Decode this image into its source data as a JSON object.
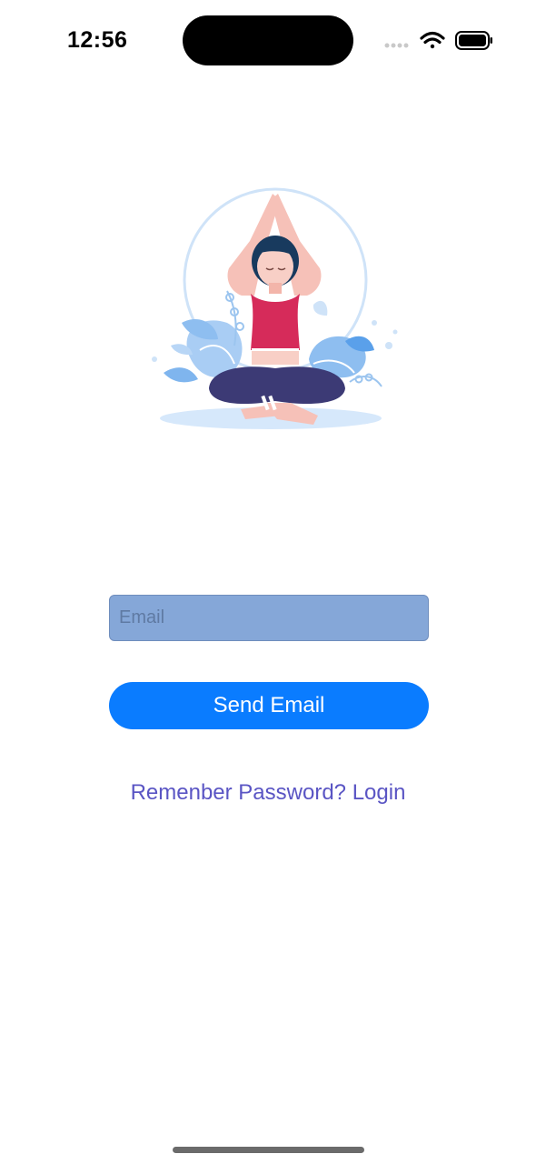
{
  "status_bar": {
    "time": "12:56",
    "icons": [
      "signal-icon",
      "wifi-icon",
      "battery-icon"
    ]
  },
  "hero": {
    "illustration": "meditation-woman-illustration"
  },
  "form": {
    "email_placeholder": "Email",
    "email_value": "",
    "send_label": "Send Email"
  },
  "footer": {
    "login_link": "Remenber Password? Login"
  },
  "colors": {
    "input_bg": "#85a7d8",
    "button_bg": "#0a7cff",
    "link": "#5a55c4"
  }
}
